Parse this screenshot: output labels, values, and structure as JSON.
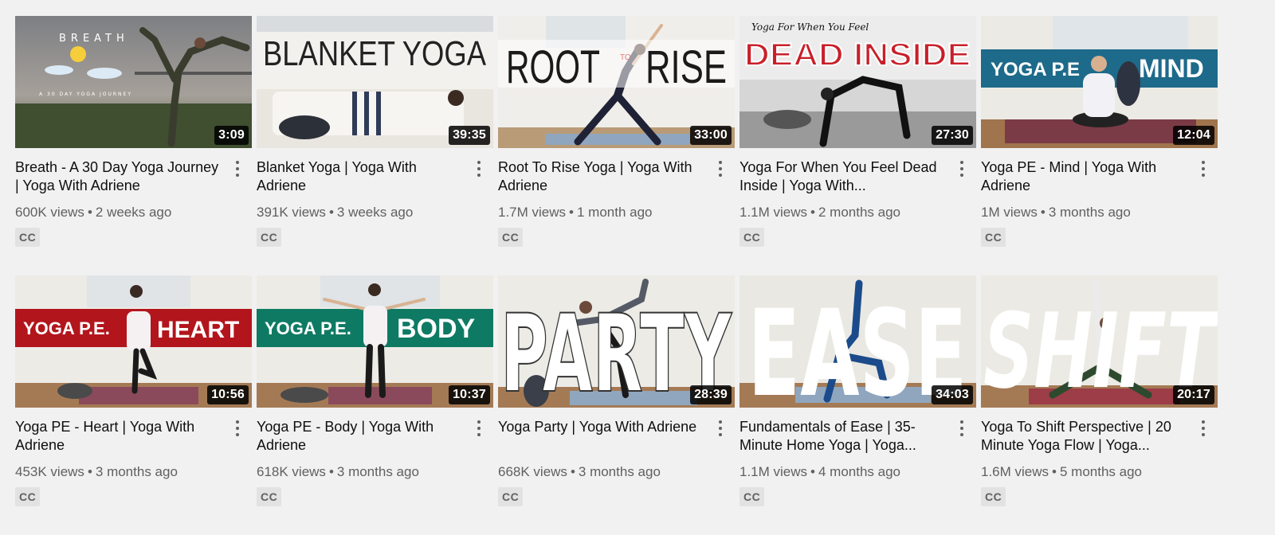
{
  "videos": [
    {
      "title": "Breath - A 30 Day Yoga Journey | Yoga With Adriene",
      "duration": "3:09",
      "views": "600K views",
      "age": "2 weeks ago",
      "badge": "CC",
      "thumb_text": "BREATH",
      "thumb_subtext": "A 30 DAY YOGA JOURNEY"
    },
    {
      "title": "Blanket Yoga | Yoga With Adriene",
      "duration": "39:35",
      "views": "391K views",
      "age": "3 weeks ago",
      "badge": "CC",
      "thumb_text": "BLANKET YOGA"
    },
    {
      "title": "Root To Rise Yoga | Yoga With Adriene",
      "duration": "33:00",
      "views": "1.7M views",
      "age": "1 month ago",
      "badge": "CC",
      "thumb_text": "ROOT",
      "thumb_subtext": "TO",
      "thumb_text2": "RISE"
    },
    {
      "title": "Yoga For When You Feel Dead Inside | Yoga With...",
      "duration": "27:30",
      "views": "1.1M views",
      "age": "2 months ago",
      "badge": "CC",
      "thumb_text": "DEAD INSIDE",
      "thumb_subtext": "Yoga For When You Feel"
    },
    {
      "title": "Yoga PE - Mind | Yoga With Adriene",
      "duration": "12:04",
      "views": "1M views",
      "age": "3 months ago",
      "badge": "CC",
      "thumb_text": "YOGA P.E",
      "thumb_text2": "MIND"
    },
    {
      "title": "Yoga PE - Heart | Yoga With Adriene",
      "duration": "10:56",
      "views": "453K views",
      "age": "3 months ago",
      "badge": "CC",
      "thumb_text": "YOGA P.E.",
      "thumb_text2": "HEART"
    },
    {
      "title": "Yoga PE - Body | Yoga With Adriene",
      "duration": "10:37",
      "views": "618K views",
      "age": "3 months ago",
      "badge": "CC",
      "thumb_text": "YOGA P.E.",
      "thumb_text2": "BODY"
    },
    {
      "title": "Yoga Party | Yoga With Adriene",
      "duration": "28:39",
      "views": "668K views",
      "age": "3 months ago",
      "badge": "CC",
      "thumb_text": "PARTY"
    },
    {
      "title": "Fundamentals of Ease | 35-Minute Home Yoga | Yoga...",
      "duration": "34:03",
      "views": "1.1M views",
      "age": "4 months ago",
      "badge": "CC",
      "thumb_text": "EASE"
    },
    {
      "title": "Yoga To Shift Perspective | 20 Minute Yoga Flow | Yoga...",
      "duration": "20:17",
      "views": "1.6M views",
      "age": "5 months ago",
      "badge": "CC",
      "thumb_text": "SHIFT"
    }
  ],
  "separator": "•",
  "colors": {
    "page_bg": "#f1f1f1",
    "title_text": "#0f0f0f",
    "meta_text": "#606060",
    "dead_inside_red": "#c8202a",
    "pe_mind_teal": "#1e6a8a",
    "pe_heart_red": "#b3151c",
    "pe_body_green": "#0f7a63"
  }
}
